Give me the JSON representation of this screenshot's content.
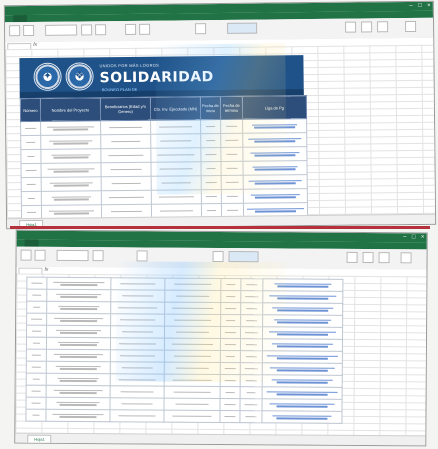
{
  "banner": {
    "subtitle": "UNIDOS POR MÁS LOGROS",
    "title": "SOLIDARIDAD",
    "tagline": "BOUNEO PLAN DE"
  },
  "columns": [
    "Número",
    "Nombre del Proyecto",
    "Beneficiarios (Edad y/o Genero)",
    "Cto. Inv. Ejecutado (MN)",
    "Fecha de inicio",
    "Fecha de término",
    "Liga de Pg"
  ],
  "colors": {
    "excel_green": "#217346",
    "banner_blue": "#1e5288",
    "header_blue": "#2d4e7a",
    "link_blue": "#2b5fb3"
  },
  "screen1": {
    "sheet_tab": "Hoja1"
  },
  "screen2": {
    "sheet_tab": "Hoja1"
  }
}
